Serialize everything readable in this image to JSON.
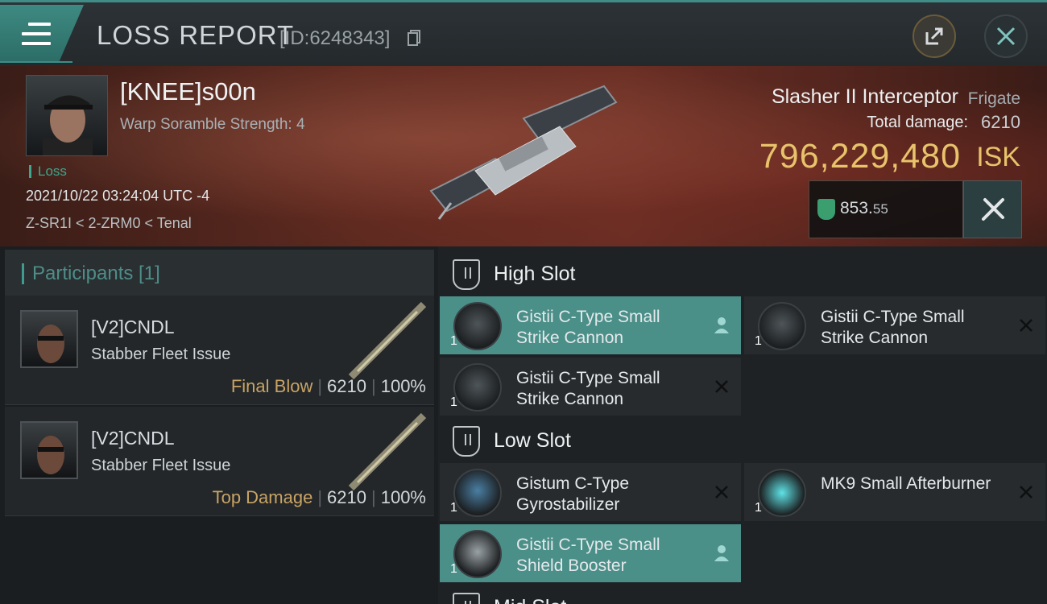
{
  "header": {
    "title": "LOSS REPORT",
    "report_id": "[ID:6248343]"
  },
  "victim": {
    "pilot": "[KNEE]s00n",
    "scramble": "Warp Soramble Strength: 4",
    "status": "Loss",
    "datetime": "2021/10/22 03:24:04 UTC -4",
    "location": "Z-SR1I < 2-ZRM0 < Tenal",
    "ship_name": "Slasher II Interceptor",
    "ship_class": "Frigate",
    "total_damage_label": "Total damage:",
    "total_damage": "6210",
    "isk_value": "796,229,480",
    "isk_unit": "ISK",
    "power_main": "853.",
    "power_decimal": "55"
  },
  "participants": {
    "heading": "Participants [1]",
    "rows": [
      {
        "name": "[V2]CNDL",
        "ship": "Stabber Fleet Issue",
        "role": "Final Blow",
        "damage": "6210",
        "percent": "100%"
      },
      {
        "name": "[V2]CNDL",
        "ship": "Stabber Fleet Issue",
        "role": "Top Damage",
        "damage": "6210",
        "percent": "100%"
      }
    ]
  },
  "fitting": {
    "high_slot": {
      "title": "High Slot",
      "modules": [
        {
          "name": "Gistii C-Type Small Strike Cannon",
          "qty": "1",
          "state": "active"
        },
        {
          "name": "Gistii C-Type Small Strike Cannon",
          "qty": "1",
          "state": "destroyed"
        },
        {
          "name": "Gistii C-Type Small Strike Cannon",
          "qty": "1",
          "state": "destroyed"
        }
      ]
    },
    "low_slot": {
      "title": "Low Slot",
      "modules": [
        {
          "name": "Gistum C-Type Gyrostabilizer",
          "qty": "1",
          "state": "destroyed"
        },
        {
          "name": "MK9 Small Afterburner",
          "qty": "1",
          "state": "destroyed"
        },
        {
          "name": "Gistii C-Type Small Shield Booster",
          "qty": "1",
          "state": "active"
        }
      ]
    },
    "mid_slot": {
      "title": "Mid Slot"
    }
  },
  "icons": {
    "menu": "menu-icon",
    "copy": "copy-icon",
    "share": "share-icon",
    "close": "close-icon",
    "power": "power-icon",
    "fit": "wrench-icon",
    "slot": "slot-shield-icon",
    "active": "person-icon",
    "destroyed": "x-icon"
  },
  "colors": {
    "accent": "#3f8d86",
    "isk": "#e8c36b",
    "role": "#c9a364",
    "loss": "#3fa58d"
  }
}
